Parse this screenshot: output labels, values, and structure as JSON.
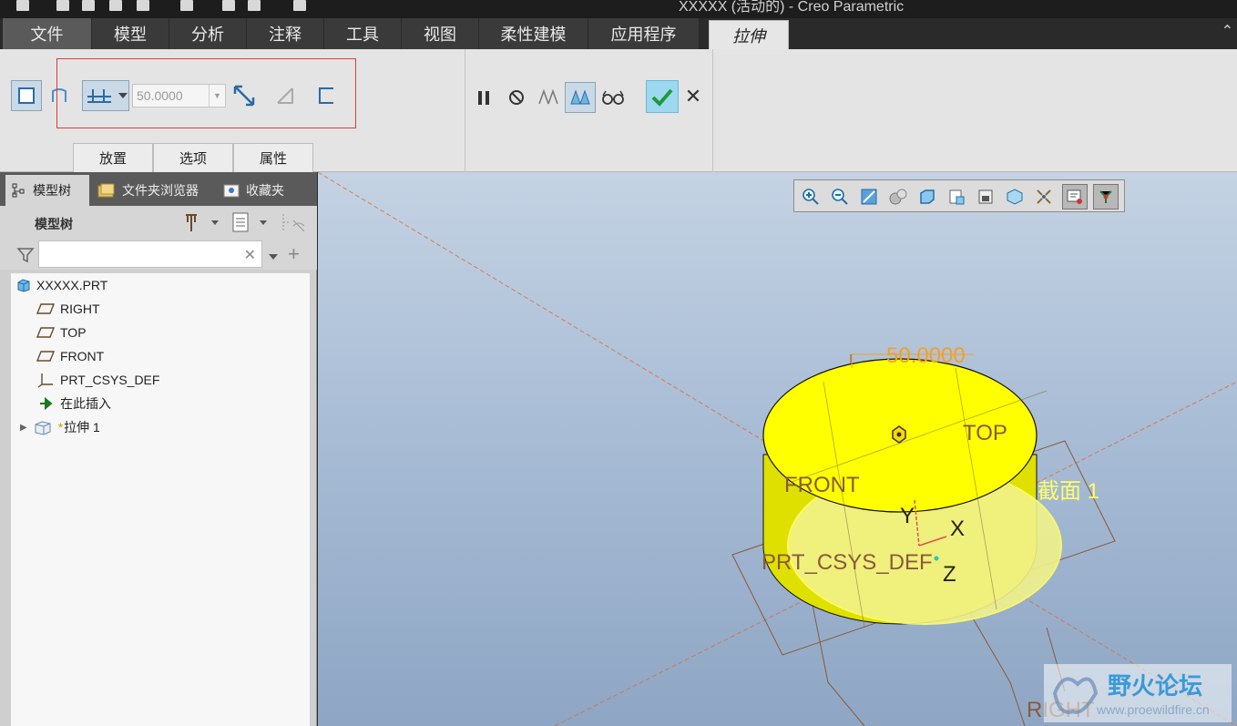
{
  "window": {
    "title": "XXXXX (活动的) - Creo Parametric"
  },
  "menu": {
    "tabs": [
      "文件",
      "模型",
      "分析",
      "注释",
      "工具",
      "视图",
      "柔性建模",
      "应用程序"
    ],
    "active_tab": "拉伸"
  },
  "ribbon": {
    "depth_value": "50.0000",
    "sub_tabs": [
      "放置",
      "选项",
      "属性"
    ],
    "ok_icon": "checkmark-icon",
    "cancel_icon": "close-icon"
  },
  "panel": {
    "tabs": [
      "模型树",
      "文件夹浏览器",
      "收藏夹"
    ],
    "tree_title": "模型树",
    "search_value": "",
    "items": [
      {
        "label": "XXXXX.PRT",
        "icon": "part-icon"
      },
      {
        "label": "RIGHT",
        "icon": "datum-plane-icon"
      },
      {
        "label": "TOP",
        "icon": "datum-plane-icon"
      },
      {
        "label": "FRONT",
        "icon": "datum-plane-icon"
      },
      {
        "label": "PRT_CSYS_DEF",
        "icon": "csys-icon"
      },
      {
        "label": "在此插入",
        "icon": "insert-arrow-icon"
      },
      {
        "label": "拉伸 1",
        "icon": "extrude-icon",
        "prefix": "*"
      }
    ]
  },
  "viewport": {
    "dimension": "50.0000",
    "labels": {
      "top": "TOP",
      "front": "FRONT",
      "section": "截面 1",
      "csys": "PRT_CSYS_DEF",
      "right": "RIGHT",
      "y": "Y",
      "x": "X",
      "z": "Z"
    },
    "colors": {
      "solid": "#f2f200",
      "dimension": "#f5a020",
      "section": "#ffff66",
      "datum": "#8a5a3a"
    },
    "watermark": {
      "title": "野火论坛",
      "url": "www.proewildfire.cn"
    }
  }
}
